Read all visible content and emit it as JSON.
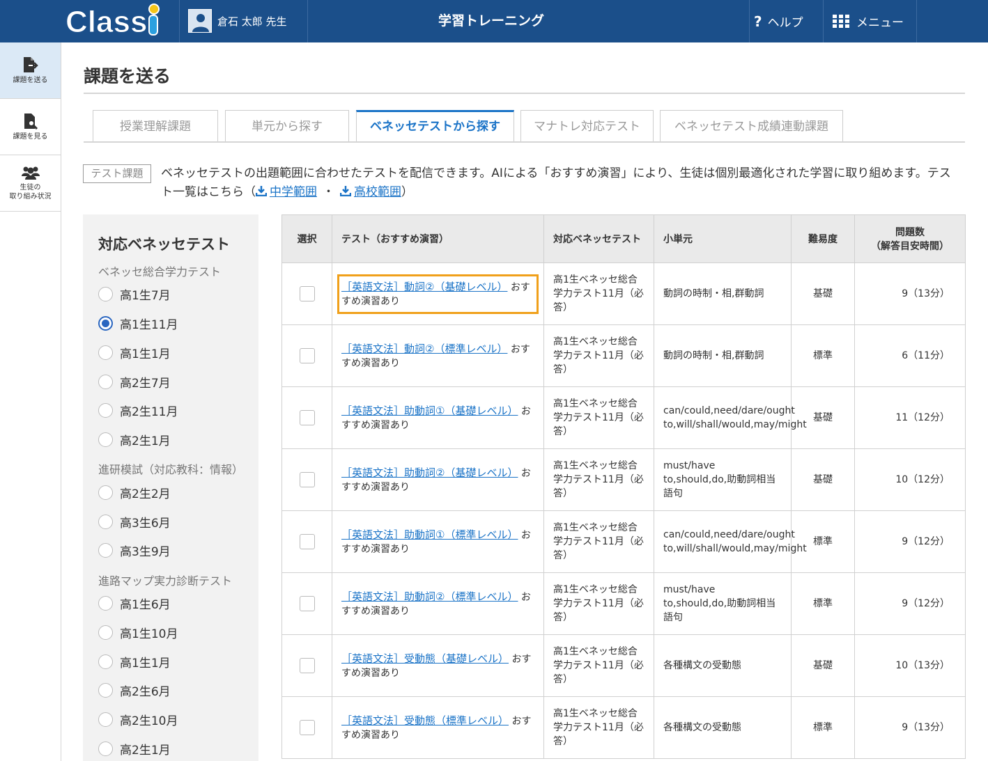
{
  "header": {
    "logo_text": "Classi",
    "user_name": "倉石 太郎 先生",
    "app_title": "学習トレーニング",
    "help_label": "ヘルプ",
    "menu_label": "メニュー"
  },
  "sidenav": {
    "items": [
      {
        "label": "課題を送る",
        "active": true
      },
      {
        "label": "課題を見る",
        "active": false
      },
      {
        "label_line1": "生徒の",
        "label_line2": "取り組み状況",
        "active": false
      }
    ]
  },
  "main": {
    "page_title": "課題を送る",
    "tabs": [
      {
        "label": "授業理解課題"
      },
      {
        "label": "単元から探す"
      },
      {
        "label": "ベネッセテストから探す",
        "active": true
      },
      {
        "label": "マナトレ対応テスト"
      },
      {
        "label": "ベネッセテスト成績連動課題"
      }
    ],
    "badge": "テスト課題",
    "description": "ベネッセテストの出題範囲に合わせたテストを配信できます。AIによる「おすすめ演習」により、生徒は個別最適化された学習に取り組めます。テスト一覧はこちら（",
    "link_middle": "中学範囲",
    "separator": "・",
    "link_high": "高校範囲",
    "description_end": "）"
  },
  "filter": {
    "title": "対応ベネッセテスト",
    "groups": [
      {
        "label": "ベネッセ総合学力テスト",
        "options": [
          "高1生7月",
          "高1生11月",
          "高1生1月",
          "高2生7月",
          "高2生11月",
          "高2生1月"
        ],
        "selected": "高1生11月"
      },
      {
        "label": "進研模試（対応教科：情報）",
        "options": [
          "高2生2月",
          "高3生6月",
          "高3生9月"
        ]
      },
      {
        "label": "進路マップ実力診断テスト",
        "options": [
          "高1生6月",
          "高1生10月",
          "高1生1月",
          "高2生6月",
          "高2生10月",
          "高2生1月"
        ]
      }
    ]
  },
  "table": {
    "headers": {
      "select": "選択",
      "test": "テスト（おすすめ演習）",
      "benesse": "対応ベネッセテスト",
      "unit": "小単元",
      "difficulty": "難易度",
      "count_line1": "問題数",
      "count_line2": "（解答目安時間）"
    },
    "rows": [
      {
        "test": "［英語文法］動詞②（基礎レベル）",
        "note": "おすすめ演習あり",
        "benesse": "高1生ベネッセ総合学力テスト11月（必答）",
        "unit": "動詞の時制・相,群動詞",
        "difficulty": "基礎",
        "count": "9（13分）",
        "highlight": true
      },
      {
        "test": "［英語文法］動詞②（標準レベル）",
        "note": "おすすめ演習あり",
        "benesse": "高1生ベネッセ総合学力テスト11月（必答）",
        "unit": "動詞の時制・相,群動詞",
        "difficulty": "標準",
        "count": "6（11分）"
      },
      {
        "test": "［英語文法］助動詞①（基礎レベル）",
        "note": "おすすめ演習あり",
        "benesse": "高1生ベネッセ総合学力テスト11月（必答）",
        "unit": "can/could,need/dare/ought to,will/shall/would,may/might",
        "difficulty": "基礎",
        "count": "11（12分）"
      },
      {
        "test": "［英語文法］助動詞②（基礎レベル）",
        "note": "おすすめ演習あり",
        "benesse": "高1生ベネッセ総合学力テスト11月（必答）",
        "unit": "must/have to,should,do,助動詞相当語句",
        "difficulty": "基礎",
        "count": "10（12分）"
      },
      {
        "test": "［英語文法］助動詞①（標準レベル）",
        "note": "おすすめ演習あり",
        "benesse": "高1生ベネッセ総合学力テスト11月（必答）",
        "unit": "can/could,need/dare/ought to,will/shall/would,may/might",
        "difficulty": "標準",
        "count": "9（12分）"
      },
      {
        "test": "［英語文法］助動詞②（標準レベル）",
        "note": "おすすめ演習あり",
        "benesse": "高1生ベネッセ総合学力テスト11月（必答）",
        "unit": "must/have to,should,do,助動詞相当語句",
        "difficulty": "標準",
        "count": "9（12分）"
      },
      {
        "test": "［英語文法］受動態（基礎レベル）",
        "note": "おすすめ演習あり",
        "benesse": "高1生ベネッセ総合学力テスト11月（必答）",
        "unit": "各種構文の受動態",
        "difficulty": "基礎",
        "count": "10（13分）"
      },
      {
        "test": "［英語文法］受動態（標準レベル）",
        "note": "おすすめ演習あり",
        "benesse": "高1生ベネッセ総合学力テスト11月（必答）",
        "unit": "各種構文の受動態",
        "difficulty": "標準",
        "count": "9（13分）"
      }
    ]
  }
}
